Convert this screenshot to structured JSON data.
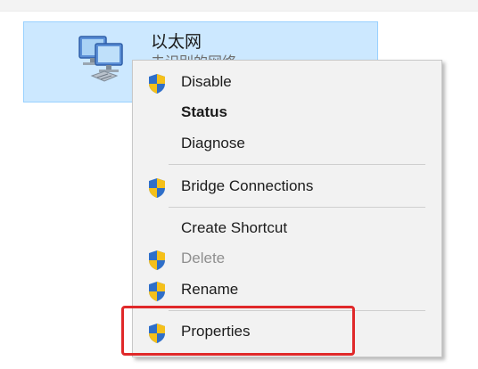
{
  "adapter": {
    "name": "以太网",
    "status": "未识别的网络",
    "icon": "network-adapter-icon"
  },
  "context_menu": {
    "items": [
      {
        "label": "Disable",
        "icon": "uac-shield-icon",
        "bold": false,
        "disabled": false
      },
      {
        "label": "Status",
        "icon": null,
        "bold": true,
        "disabled": false
      },
      {
        "label": "Diagnose",
        "icon": null,
        "bold": false,
        "disabled": false
      },
      {
        "label": "Bridge Connections",
        "icon": "uac-shield-icon",
        "bold": false,
        "disabled": false
      },
      {
        "label": "Create Shortcut",
        "icon": null,
        "bold": false,
        "disabled": false
      },
      {
        "label": "Delete",
        "icon": "uac-shield-icon",
        "bold": false,
        "disabled": true
      },
      {
        "label": "Rename",
        "icon": "uac-shield-icon",
        "bold": false,
        "disabled": false
      },
      {
        "label": "Properties",
        "icon": "uac-shield-icon",
        "bold": false,
        "disabled": false
      }
    ]
  },
  "colors": {
    "tile_background": "#cce8ff",
    "menu_background": "#f2f2f2",
    "highlight_border": "#e0292a",
    "shield_blue": "#2f6fc9",
    "shield_yellow": "#f5c01a"
  }
}
